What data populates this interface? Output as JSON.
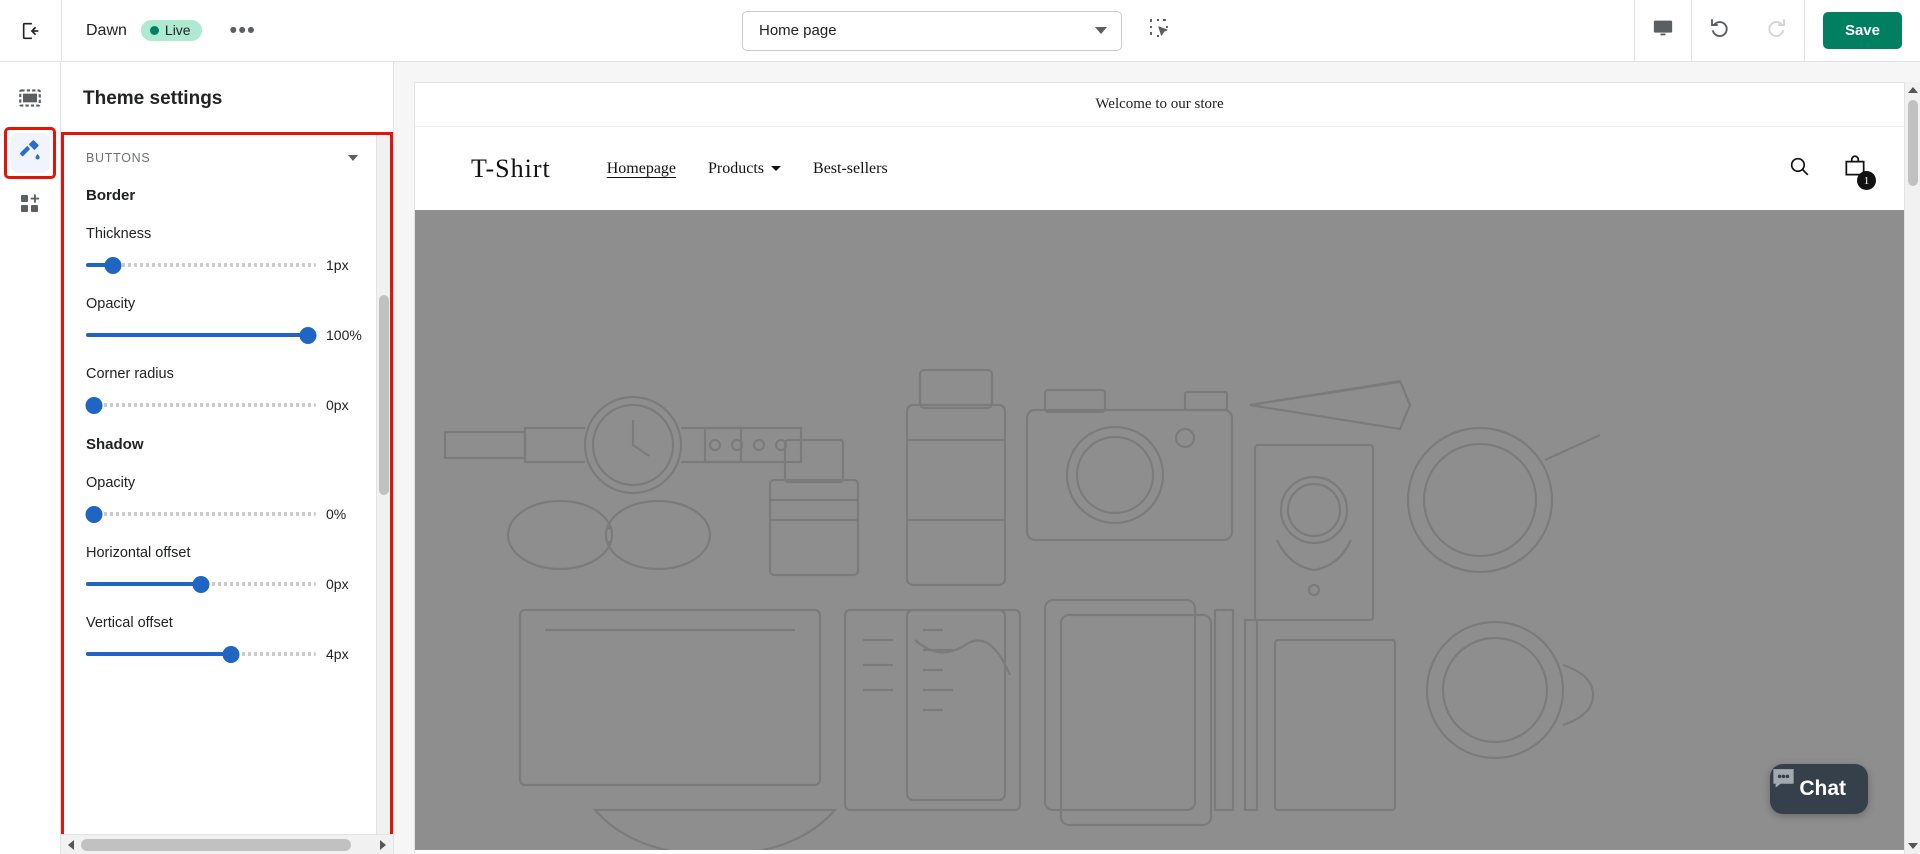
{
  "topbar": {
    "exit_icon": "exit-to-app-icon",
    "theme_name": "Dawn",
    "live_label": "Live",
    "more_label": "•••",
    "page_selector_value": "Home page",
    "select_tool_icon": "selection-cursor-icon",
    "device_icon": "desktop-preview-icon",
    "undo_icon": "undo-icon",
    "redo_icon": "redo-icon",
    "save_label": "Save",
    "accent_green": "#008060",
    "live_badge_bg": "#aee9d1"
  },
  "rail": {
    "items": [
      {
        "name": "sections-icon",
        "label": "Sections",
        "active": false
      },
      {
        "name": "theme-settings-brush-icon",
        "label": "Theme settings",
        "active": true
      },
      {
        "name": "app-blocks-icon",
        "label": "App embeds",
        "active": false
      }
    ],
    "highlight_color": "#e4140d"
  },
  "panel": {
    "title": "Theme settings",
    "group_label": "BUTTONS",
    "collapse_icon": "chevron-down-icon",
    "sections": [
      {
        "heading": "Border",
        "fields": [
          {
            "label": "Thickness",
            "value": "1px",
            "percent": 9
          },
          {
            "label": "Opacity",
            "value": "100%",
            "percent": 100
          },
          {
            "label": "Corner radius",
            "value": "0px",
            "percent": 0
          }
        ]
      },
      {
        "heading": "Shadow",
        "fields": [
          {
            "label": "Opacity",
            "value": "0%",
            "percent": 0
          },
          {
            "label": "Horizontal offset",
            "value": "0px",
            "percent": 50
          },
          {
            "label": "Vertical offset",
            "value": "4px",
            "percent": 64
          }
        ]
      }
    ],
    "slider_color": "#1f66c4",
    "scroll_left_icon": "scroll-left-arrow-icon",
    "scroll_right_icon": "scroll-right-arrow-icon"
  },
  "preview": {
    "announcement": "Welcome to our store",
    "logo": "T-Shirt",
    "nav": [
      {
        "label": "Homepage",
        "current": true,
        "has_dropdown": false
      },
      {
        "label": "Products",
        "current": false,
        "has_dropdown": true
      },
      {
        "label": "Best-sellers",
        "current": false,
        "has_dropdown": false
      }
    ],
    "search_icon": "search-icon",
    "cart_icon": "shopping-bag-icon",
    "cart_count": "1",
    "hero_bg": "#8e8e8e",
    "chat_label": "Chat",
    "chat_icon": "chat-bubble-icon",
    "scroll_up_icon": "scroll-up-arrow-icon",
    "scroll_down_icon": "scroll-down-arrow-icon"
  }
}
